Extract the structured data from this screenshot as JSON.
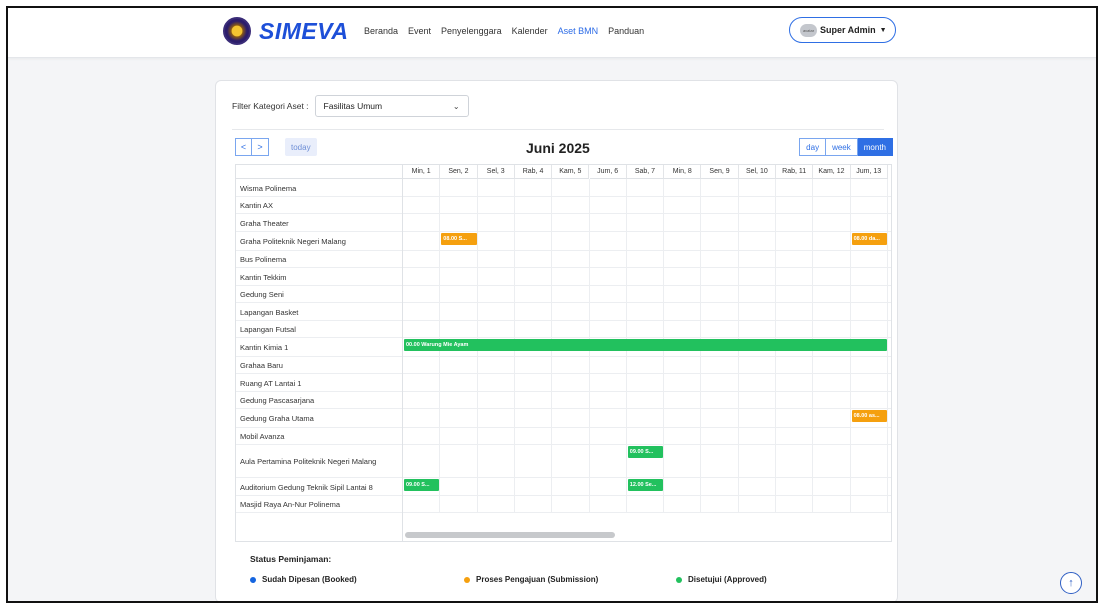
{
  "navbar": {
    "brand": "SIMEVA",
    "menu": [
      {
        "label": "Beranda",
        "active": false
      },
      {
        "label": "Event",
        "active": false
      },
      {
        "label": "Penyelenggara",
        "active": false
      },
      {
        "label": "Kalender",
        "active": false
      },
      {
        "label": "Aset BMN",
        "active": true
      },
      {
        "label": "Panduan",
        "active": false
      }
    ],
    "user": {
      "avatar_text": "avatar",
      "name": "Super Admin",
      "caret": "▼"
    }
  },
  "filter": {
    "label": "Filter Kategori Aset :",
    "value": "Fasilitas Umum",
    "chevron": "⌄"
  },
  "calendar": {
    "prev": "<",
    "next": ">",
    "today": "today",
    "title": "Juni 2025",
    "views": [
      {
        "label": "day",
        "active": false
      },
      {
        "label": "week",
        "active": false
      },
      {
        "label": "month",
        "active": true
      }
    ],
    "days": [
      "Min, 1",
      "Sen, 2",
      "Sel, 3",
      "Rab, 4",
      "Kam, 5",
      "Jum, 6",
      "Sab, 7",
      "Min, 8",
      "Sen, 9",
      "Sel, 10",
      "Rab, 11",
      "Kam, 12",
      "Jum, 13"
    ],
    "resources": [
      "Wisma Polinema",
      "Kantin AX",
      "Graha Theater",
      "Graha Politeknik Negeri Malang",
      "Bus Polinema",
      "Kantin Tekkim",
      "Gedung Seni",
      "Lapangan Basket",
      "Lapangan Futsal",
      "Kantin Kimia 1",
      "Grahaa Baru",
      "Ruang AT Lantai 1",
      "Gedung Pascasarjana",
      "Gedung Graha Utama",
      "Mobil Avanza",
      "Aula Pertamina Politeknik Negeri Malang",
      "Auditorium Gedung Teknik Sipil Lantai 8",
      "Masjid Raya An-Nur Polinema"
    ],
    "events": [
      {
        "row": 3,
        "day": 1,
        "span": 1,
        "label": "08.00 S...",
        "status": "submission"
      },
      {
        "row": 3,
        "day": 12,
        "span": 1,
        "label": "08.00 da...",
        "status": "submission"
      },
      {
        "row": 9,
        "day": 0,
        "span": 13,
        "label": "00.00 Warung Mie Ayam",
        "status": "approved"
      },
      {
        "row": 13,
        "day": 12,
        "span": 1,
        "label": "08.00 as...",
        "status": "submission"
      },
      {
        "row": 15,
        "day": 6,
        "span": 1,
        "label": "09.00 S...",
        "status": "approved"
      },
      {
        "row": 16,
        "day": 0,
        "span": 1,
        "label": "09.00 S...",
        "status": "approved"
      },
      {
        "row": 16,
        "day": 6,
        "span": 1,
        "label": "12.00 Se...",
        "status": "approved"
      }
    ]
  },
  "legend": {
    "title": "Status Peminjaman:",
    "items": [
      {
        "label": "Sudah Dipesan (Booked)",
        "color": "#1565e0"
      },
      {
        "label": "Proses Pengajuan (Submission)",
        "color": "#f5a00f"
      },
      {
        "label": "Disetujui (Approved)",
        "color": "#22c15e"
      }
    ]
  },
  "colors": {
    "submission": "#f5a00f",
    "approved": "#22c15e",
    "booked": "#1565e0",
    "accent": "#2f6fe4"
  },
  "scroll_top_icon": "↑"
}
